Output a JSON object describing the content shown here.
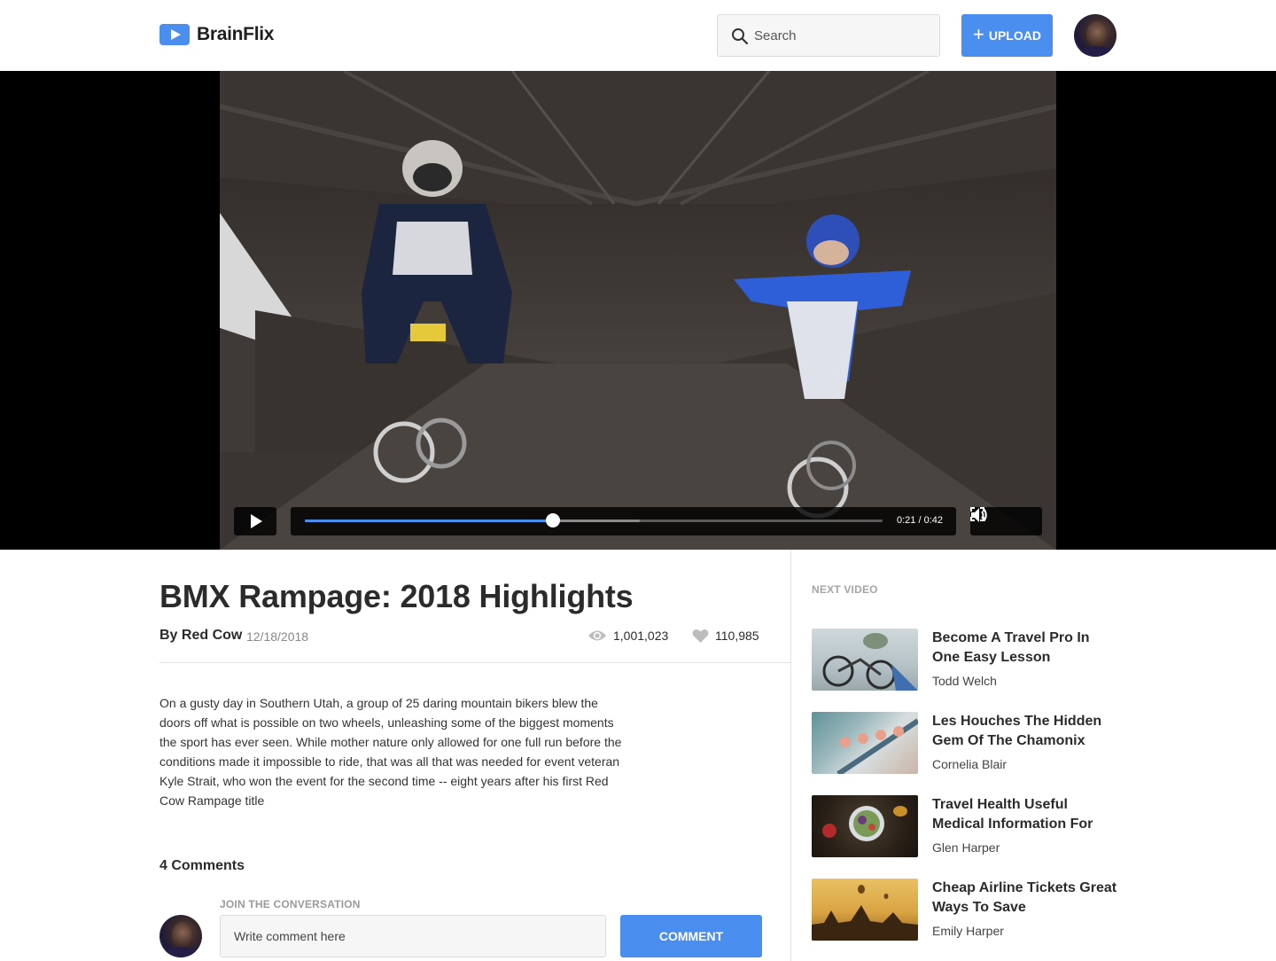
{
  "header": {
    "logo_text": "BrainFlix",
    "search_placeholder": "Search",
    "upload_label": "UPLOAD"
  },
  "video": {
    "current_time": "0:21",
    "duration": "0:42",
    "timecode": "0:21 / 0:42",
    "progress_fraction": 0.43,
    "buffered_fraction": 0.58
  },
  "details": {
    "title": "BMX Rampage: 2018 Highlights",
    "byline": "By Red Cow",
    "date": "12/18/2018",
    "views": "1,001,023",
    "likes": "110,985",
    "description": "On a gusty day in Southern Utah, a group of 25 daring mountain bikers blew the doors off what is possible on two wheels, unleashing some of the biggest moments the sport has ever seen. While mother nature only allowed for one full run before the conditions made it impossible to ride, that was all that was needed for event veteran Kyle Strait, who won the event for the second time -- eight years after his first Red Cow Rampage title"
  },
  "comments": {
    "count_label": "4 Comments",
    "join_label": "JOIN THE CONVERSATION",
    "input_placeholder": "Write comment here",
    "button_label": "COMMENT"
  },
  "sidebar": {
    "heading": "NEXT VIDEO",
    "items": [
      {
        "title": "Become A Travel Pro In One Easy Lesson",
        "author": "Todd Welch"
      },
      {
        "title": "Les Houches The Hidden Gem Of The Chamonix",
        "author": "Cornelia Blair"
      },
      {
        "title": "Travel Health Useful Medical Information For",
        "author": "Glen Harper"
      },
      {
        "title": "Cheap Airline Tickets Great Ways To Save",
        "author": "Emily Harper"
      }
    ]
  },
  "colors": {
    "accent": "#4a8ef0",
    "text_dark": "#2b2b2b",
    "muted": "#9a9a9a"
  },
  "icons": {
    "logo": "play-logo-icon",
    "search": "search-icon",
    "upload": "plus-icon",
    "play": "play-icon",
    "fullscreen": "fullscreen-icon",
    "volume": "volume-icon",
    "views": "eye-icon",
    "likes": "heart-icon"
  }
}
